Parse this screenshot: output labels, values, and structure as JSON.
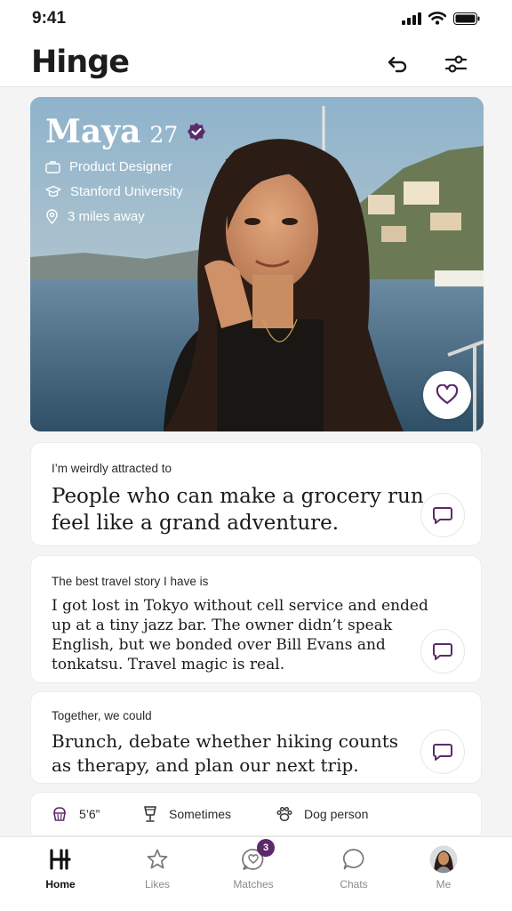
{
  "status_bar": {
    "time": "9:41"
  },
  "app": {
    "logo": "Hinge",
    "accent": "#5c2a6b"
  },
  "header": {
    "undo_icon": "undo-icon",
    "filter_icon": "filters-icon"
  },
  "profile": {
    "name": "Maya",
    "age": "27",
    "verified_icon": "verified-badge-icon",
    "job": "Product Designer",
    "school": "Stanford University",
    "distance": "3 miles away"
  },
  "prompts": [
    {
      "title": "I’m weirdly attracted to",
      "answer_lines": [
        "People who can make a grocery run",
        "feel like a grand adventure."
      ]
    },
    {
      "title": "The best travel story I have is",
      "answer_lines": [
        "I got lost in Tokyo without cell service and ended",
        "up at a tiny jazz bar. The owner didn’t speak",
        "English, but we bonded over Bill Evans and",
        "tonkatsu. Travel magic is real."
      ]
    },
    {
      "title": "Together, we could",
      "answer_lines": [
        "Brunch, debate whether hiking counts",
        "as therapy, and plan our next trip."
      ]
    }
  ],
  "facts": [
    {
      "icon": "height-icon",
      "label": "5’6”"
    },
    {
      "icon": "drink-icon",
      "label": "Sometimes"
    },
    {
      "icon": "paw-icon",
      "label": "Dog person"
    }
  ],
  "nav": [
    {
      "label": "Home",
      "icon": "home-icon"
    },
    {
      "label": "Likes",
      "icon": "star-icon"
    },
    {
      "label": "Matches",
      "icon": "heart-chat-icon",
      "badge": "3"
    },
    {
      "label": "Chats",
      "icon": "chat-icon"
    },
    {
      "label": "Me",
      "icon": "avatar"
    }
  ]
}
